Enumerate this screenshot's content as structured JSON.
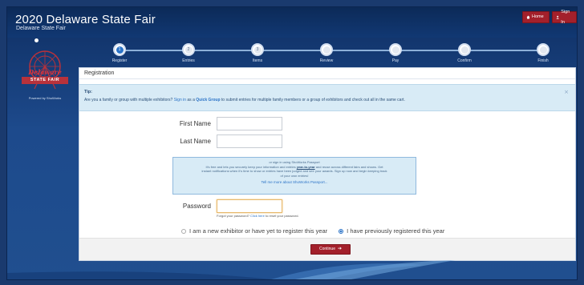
{
  "header": {
    "title": "2020 Delaware State Fair",
    "subtitle": "Delaware State Fair",
    "home_label": "Home",
    "signin_label": "Sign In"
  },
  "logo": {
    "text": "STATE FAIR",
    "script_text": "Delaware",
    "powered_by": "Powered by ShoWorks"
  },
  "steps": [
    {
      "num": "1",
      "label": "Register",
      "active": true
    },
    {
      "num": "2",
      "label": "Entries",
      "active": false
    },
    {
      "num": "3",
      "label": "Items",
      "active": false
    },
    {
      "num": "",
      "label": "Review",
      "active": false
    },
    {
      "num": "",
      "label": "Pay",
      "active": false
    },
    {
      "num": "",
      "label": "Confirm",
      "active": false
    },
    {
      "num": "",
      "label": "Finish",
      "active": false
    }
  ],
  "panel": {
    "title": "Registration",
    "tip": {
      "title": "Tip:",
      "text_1": "Are you a family or group with multiple exhibitors?",
      "sign_in_link": "Sign in",
      "text_2": "as a",
      "quick_group_link": "Quick Group",
      "text_3": "to submit entries for multiple family members or a group of exhibitors and check out all in the same cart.",
      "close": "×"
    },
    "form": {
      "first_name_label": "First Name",
      "first_name_value": "",
      "last_name_label": "Last Name",
      "last_name_value": "",
      "passport": {
        "line_1": "or sign in using ShoWorks Passport",
        "line_2a": "It's free and lets you securely keep your information and entries",
        "line_2b": "year-to-year",
        "line_2c": "and reuse across different fairs and shows. Get",
        "line_3": "instant notifications when it's time to show or entries have been judged and see your awards. Sign up now and begin keeping track",
        "line_4": "of your own entries!",
        "more_link": "Tell me more about ShoWorks Passport..."
      },
      "password_label": "Password",
      "password_value": "",
      "forgot_text": "Forgot your password?",
      "forgot_link": "Click here",
      "forgot_tail": "to reset your password.",
      "radio_new": "I am a new exhibitor or have yet to register this year",
      "radio_previous": "I have previously registered this year",
      "radio_selected": "previous"
    },
    "continue_label": "Continue"
  },
  "colors": {
    "accent_red": "#a3202b",
    "link_blue": "#2b73c7",
    "background_navy": "#1d4a8c"
  }
}
